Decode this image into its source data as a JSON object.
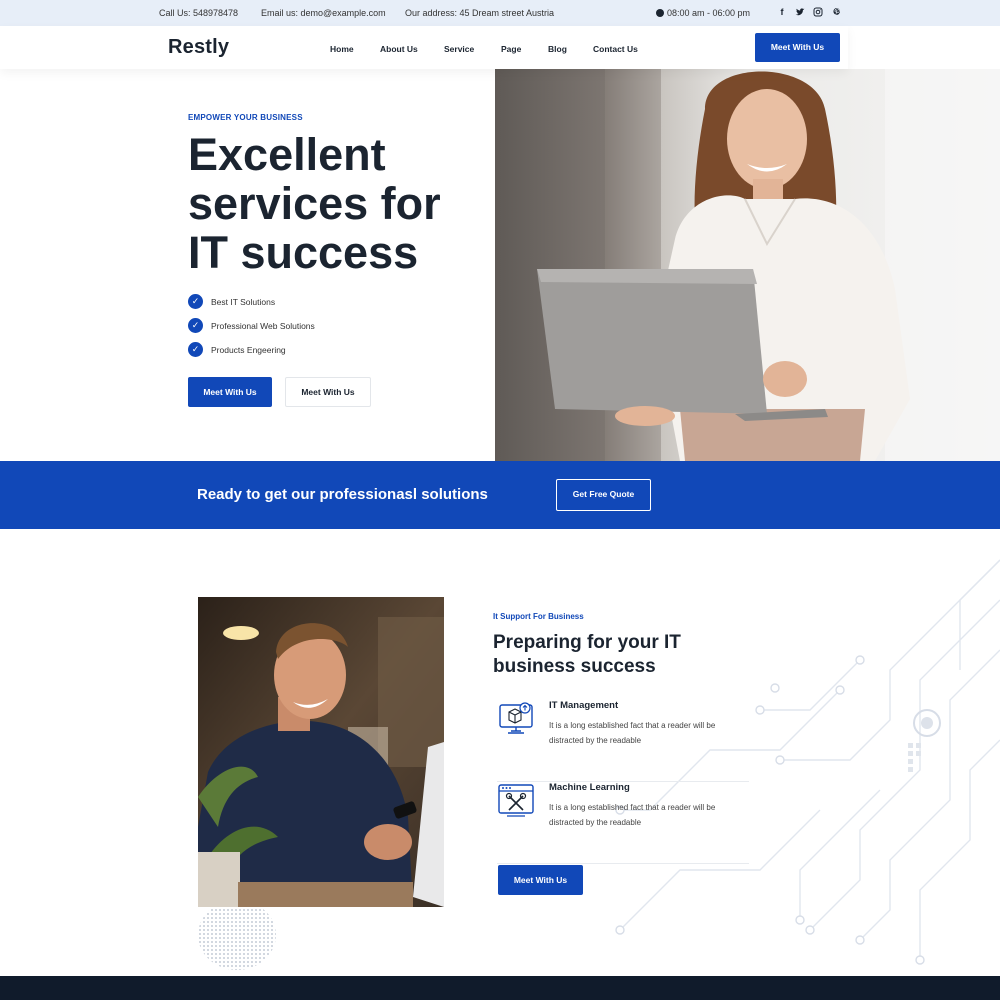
{
  "topbar": {
    "phone": "Call Us: 548978478",
    "email": "Email us: demo@example.com",
    "address": "Our address: 45 Dream street Austria",
    "hours": "08:00 am - 06:00 pm",
    "social": [
      "facebook-icon",
      "twitter-icon",
      "instagram-icon",
      "pinterest-icon"
    ]
  },
  "nav": {
    "logo": "Restly",
    "links": [
      "Home",
      "About Us",
      "Service",
      "Page",
      "Blog",
      "Contact Us"
    ],
    "cta": "Meet With Us"
  },
  "hero": {
    "eyebrow": "EMPOWER YOUR BUSINESS",
    "title": "Excellent services for IT success",
    "features": [
      "Best IT Solutions",
      "Professional Web Solutions",
      "Products Engeering"
    ],
    "primary_button": "Meet With Us",
    "secondary_button": "Meet With Us"
  },
  "band": {
    "text": "Ready to get our professionasl solutions",
    "button": "Get Free Quote"
  },
  "section": {
    "eyebrow": "It Support For Business",
    "title": "Preparing for your IT business success",
    "services": [
      {
        "title": "IT Management",
        "desc": "It is a long established fact that a reader will be distracted by the readable",
        "icon": "monitor-cube-icon"
      },
      {
        "title": "Machine Learning",
        "desc": "It is a long established fact that a reader will be distracted by the readable",
        "icon": "browser-tools-icon"
      }
    ],
    "button": "Meet With Us"
  },
  "colors": {
    "accent": "#1148b8",
    "dark": "#1b2430",
    "topbar_bg": "#e7eef8",
    "footer": "#101b2b"
  }
}
